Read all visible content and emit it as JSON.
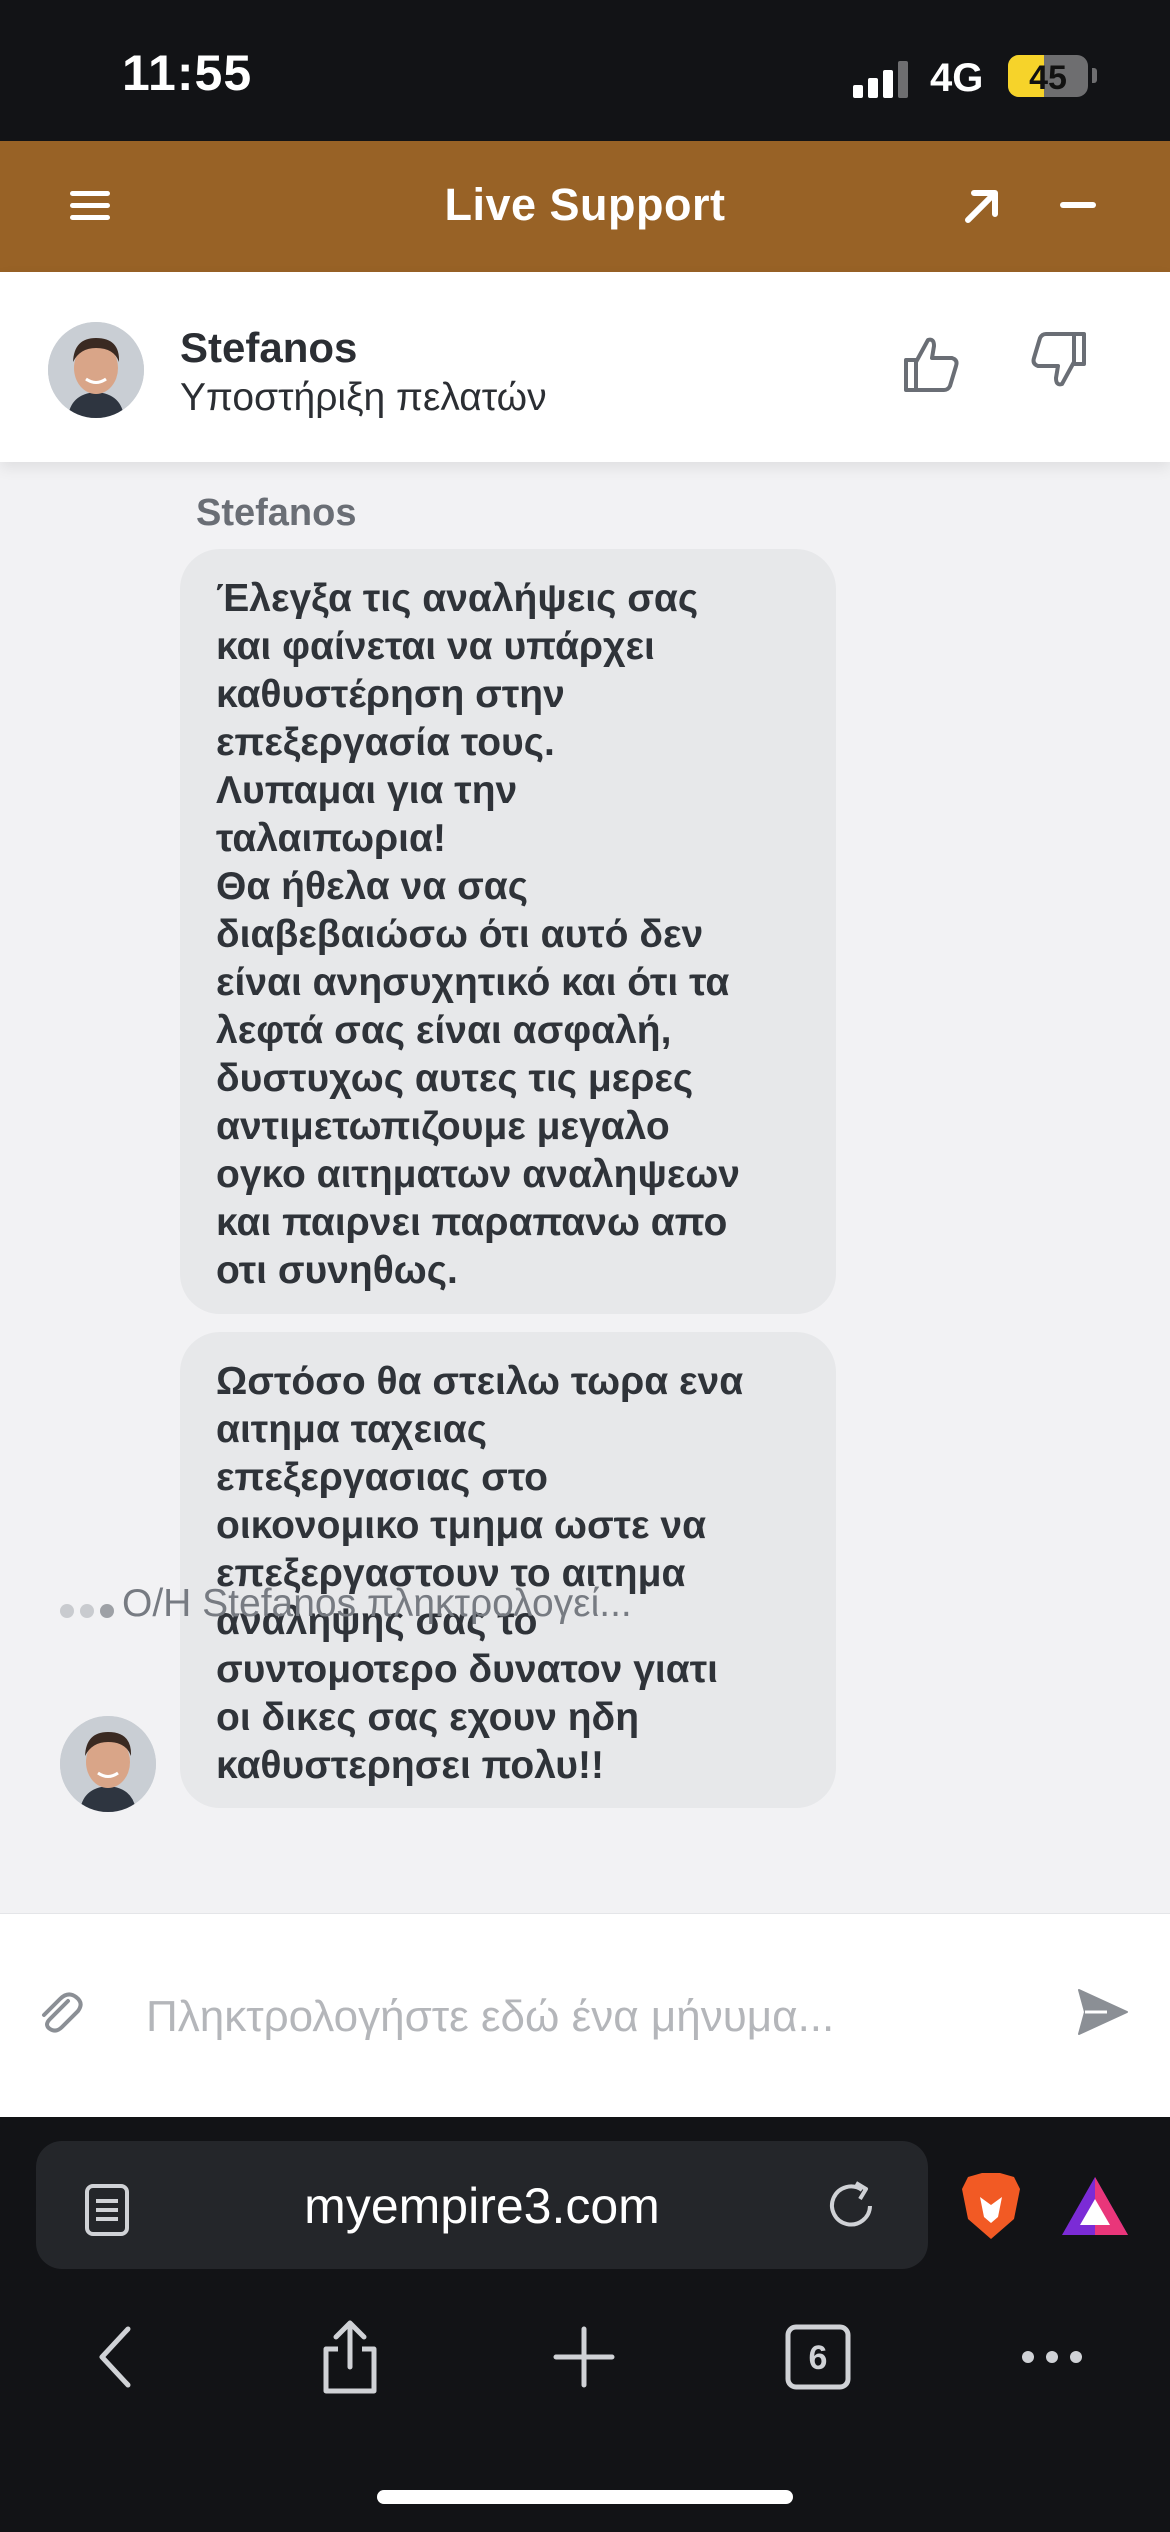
{
  "status_bar": {
    "time": "11:55",
    "network": "4G",
    "battery_level": "45",
    "battery_fraction": 0.45
  },
  "widget": {
    "title": "Live Support",
    "accent_color": "#986226"
  },
  "agent": {
    "name": "Stefanos",
    "role": "Υποστήριξη πελατών"
  },
  "conversation": {
    "sender_label": "Stefanos",
    "messages": [
      {
        "sender": "Stefanos",
        "text": "Έλεγξα τις αναλήψεις σας\nκαι φαίνεται να υπάρχει\nκαθυστέρηση στην\nεπεξεργασία τους.\nΛυπαμαι για την\nταλαιπωρια!\nΘα ήθελα να σας\nδιαβεβαιώσω ότι αυτό δεν\nείναι ανησυχητικό και ότι τα\nλεφτά σας είναι ασφαλή,\nδυστυχως αυτες τις μερες\nαντιμετωπιζουμε μεγαλο\nογκο αιτηματων αναληψεων\nκαι παιρνει παραπανω απο\nοτι συνηθως."
      },
      {
        "sender": "Stefanos",
        "text": "Ωστόσο θα στειλω τωρα ενα\nαιτημα ταχειας\nεπεξεργασιας στο\nοικονομικο τμημα ωστε να\nεπεξεργαστουν το αιτημα\nαναληψης σας το\nσυντομοτερο δυνατον γιατι\nοι δικες σας εχουν ηδη\nκαθυστερησει πολυ!!"
      }
    ],
    "typing_indicator": "Ο/Η Stefanos πληκτρολογεί..."
  },
  "composer": {
    "placeholder": "Πληκτρολογήστε εδώ ένα μήνυμα...",
    "value": ""
  },
  "browser": {
    "url": "myempire3.com",
    "tab_count": "6"
  },
  "icons": {
    "menu": "menu-icon",
    "popout": "popout-arrow-icon",
    "minimize": "minimize-icon",
    "like": "thumbs-up-icon",
    "dislike": "thumbs-down-icon",
    "attach": "paperclip-icon",
    "send": "send-icon",
    "reader": "page-icon",
    "reload": "reload-icon",
    "brave": "brave-lion-icon",
    "rewards": "brave-rewards-icon",
    "back": "back-icon",
    "share": "share-icon",
    "new_tab": "plus-icon",
    "tabs": "tabs-icon",
    "more": "more-icon"
  }
}
